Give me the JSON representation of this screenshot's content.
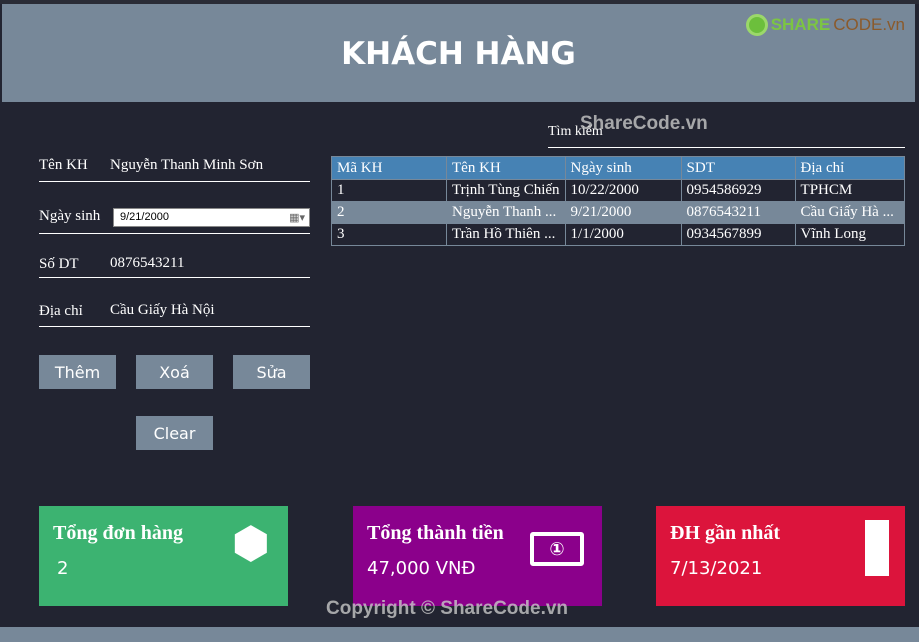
{
  "header": {
    "title": "KHÁCH HÀNG",
    "logo": "SHARECODE.vn",
    "logo_a": "SHARE",
    "logo_b": "CODE.vn"
  },
  "form": {
    "name_label": "Tên KH",
    "name_value": "Nguyễn Thanh Minh Sơn",
    "dob_label": "Ngày sinh",
    "dob_value": "9/21/2000",
    "phone_label": "Số DT",
    "phone_value": "0876543211",
    "address_label": "Địa chỉ",
    "address_value": "Cầu Giấy Hà Nội"
  },
  "buttons": {
    "add": "Thêm",
    "delete": "Xoá",
    "edit": "Sửa",
    "clear": "Clear"
  },
  "search": {
    "label": "Tìm kiếm"
  },
  "table": {
    "headers": [
      "Mã KH",
      "Tên KH",
      "Ngày sinh",
      "SDT",
      "Địa chỉ"
    ],
    "rows": [
      [
        "1",
        "Trịnh Tùng Chiến",
        "10/22/2000",
        "0954586929",
        "TPHCM"
      ],
      [
        "2",
        "Nguyễn Thanh ...",
        "9/21/2000",
        "0876543211",
        "Cầu Giấy Hà ..."
      ],
      [
        "3",
        "Trần Hồ Thiên ...",
        "1/1/2000",
        "0934567899",
        "Vĩnh Long"
      ]
    ],
    "selected_row": 1
  },
  "cards": [
    {
      "title": "Tổng đơn hàng",
      "value": "2",
      "icon": "cubes-icon",
      "color": "#3cb371"
    },
    {
      "title": "Tổng thành tiền",
      "value": "47,000 VNĐ",
      "icon": "money-bill-icon",
      "color": "#8b008b"
    },
    {
      "title": "ĐH gần nhất",
      "value": "7/13/2021",
      "icon": "receipt-icon",
      "color": "#dc143c"
    }
  ],
  "watermarks": {
    "top": "ShareCode.vn",
    "bottom": "Copyright © ShareCode.vn"
  }
}
